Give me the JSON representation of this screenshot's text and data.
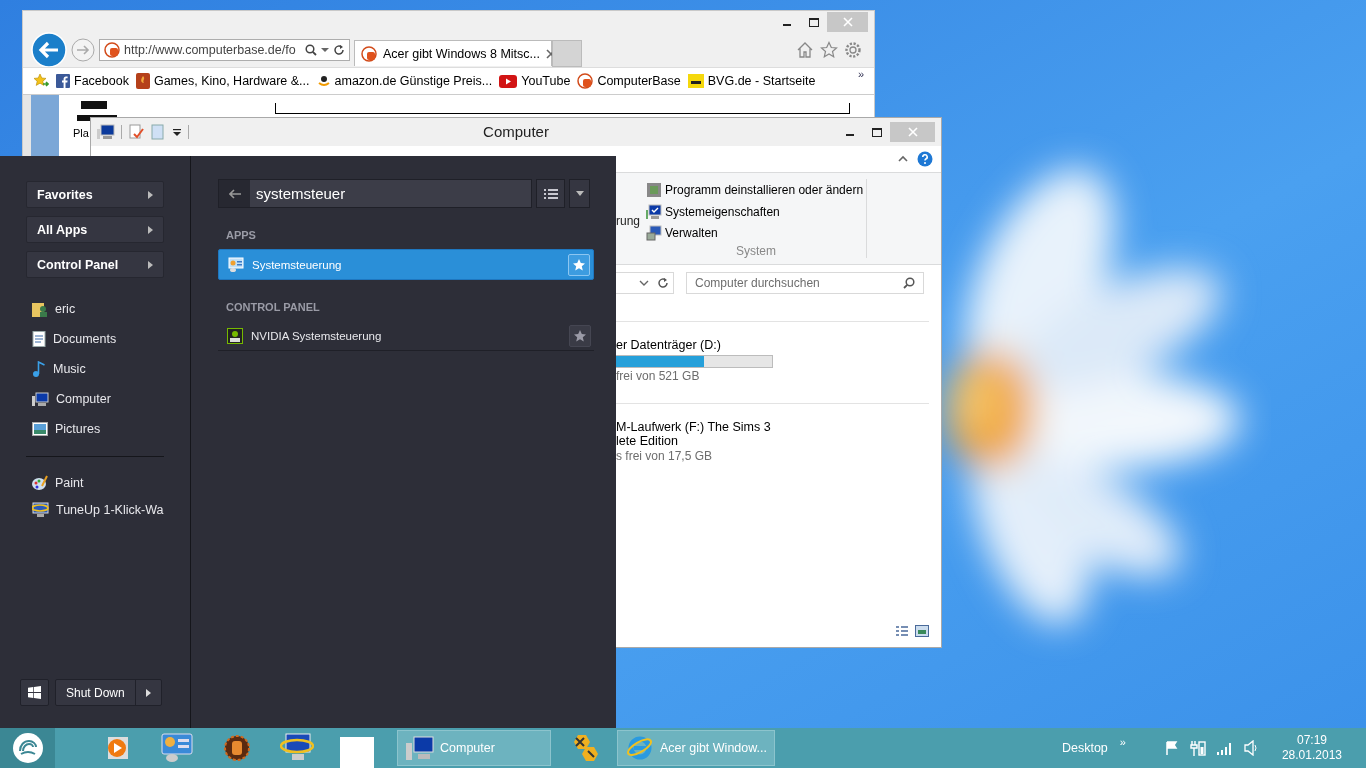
{
  "browser": {
    "address": "http://www.computerbase.de/fo",
    "tabs": [
      {
        "label": "Acer gibt Windows 8 Mitsc...",
        "selected": true
      }
    ],
    "favorites": [
      "Facebook",
      "Games, Kino, Hardware &...",
      "amazon.de Günstige Preis...",
      "YouTube",
      "ComputerBase",
      "BVG.de - Startseite"
    ],
    "favorites_more": "»",
    "page_text": "Pla"
  },
  "explorer": {
    "title": "Computer",
    "ribbon_fragment": "rung",
    "ribbon_items": [
      "Programm deinstallieren oder ändern",
      "Systemeigenschaften",
      "Verwalten"
    ],
    "ribbon_group": "System",
    "search": {
      "placeholder": "Computer durchsuchen"
    },
    "drives": [
      {
        "kind": "disk",
        "name": [
          "er Datenträger (D:)"
        ],
        "level": 0.62,
        "free": "frei von 521 GB"
      },
      {
        "kind": "optical",
        "name": [
          "M-Laufwerk (F:) The Sims 3",
          "lete Edition"
        ],
        "free": "s frei von 17,5 GB"
      }
    ]
  },
  "start_menu": {
    "nav_buttons": [
      "Favorites",
      "All Apps",
      "Control Panel"
    ],
    "places": [
      "eric",
      "Documents",
      "Music",
      "Computer",
      "Pictures"
    ],
    "recent": [
      "Paint",
      "TuneUp 1-Klick-Wa"
    ],
    "search": {
      "value": "systemsteuer"
    },
    "results": [
      {
        "kind": "header",
        "label": "APPS"
      },
      {
        "kind": "item",
        "label": "Systemsteuerung",
        "selected": true
      },
      {
        "kind": "header",
        "label": "CONTROL PANEL"
      },
      {
        "kind": "item",
        "label": "NVIDIA Systemsteuerung",
        "selected": false
      }
    ],
    "shutdown": "Shut Down"
  },
  "taskbar": {
    "windows": [
      {
        "label": "Computer"
      },
      {
        "label": "Acer gibt Window..."
      }
    ],
    "toolbar": {
      "label": "Desktop",
      "chevron": "»"
    },
    "clock": {
      "time": "07:19",
      "date": "28.01.2013"
    }
  }
}
